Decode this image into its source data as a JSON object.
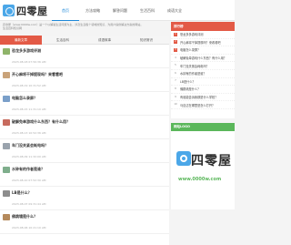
{
  "site": {
    "logo_text": "四零屋"
  },
  "nav": [
    {
      "label": "首页",
      "active": true
    },
    {
      "label": "方法攻略",
      "active": false
    },
    {
      "label": "解答问题",
      "active": false
    },
    {
      "label": "生活百科",
      "active": false
    },
    {
      "label": "成语大全",
      "active": false
    }
  ],
  "notice": {
    "line1": "四零屋（www.0000w.com）是一个以解答生活问题为主，涉及生活各个领域的知识，为用户提供解决方案的网站。",
    "line2": "生活百科知识网"
  },
  "tabs": [
    {
      "label": "最新文章",
      "active": true
    },
    {
      "label": "生活百科",
      "active": false
    },
    {
      "label": "成语故事",
      "active": false
    },
    {
      "label": "知识常识",
      "active": false
    }
  ],
  "articles": [
    {
      "title": "恐龙多多游戏评测",
      "date": "2023-08-18 07:50:36 AM",
      "tag": "",
      "thumb": "#8fb46a"
    },
    {
      "title": "开心麻将干掉提现吗？来看看吧",
      "date": "2023-08-19 10:31:52 AM",
      "tag": "",
      "thumb": "#c9a37a"
    },
    {
      "title": "电脑怎么录屏？",
      "date": "2023-08-15 11:31:10 AM",
      "tag": "",
      "thumb": "#7a9fc9"
    },
    {
      "title": "破解免单游戏什么东西？有什么用？",
      "date": "2023-08-13 10:52:36 AM",
      "tag": "",
      "thumb": "#c76b5e"
    },
    {
      "title": "车门没关紧会耗电吗？",
      "date": "2023-08-09 11:32:00 AM",
      "tag": "",
      "thumb": "#9aa3ad"
    },
    {
      "title": "水钟有的作者是谁？",
      "date": "2023-08-10 07:52:30 AM",
      "tag": "",
      "thumb": "#7fae8c"
    },
    {
      "title": "LB是什么？",
      "date": "2023-08-07 09:31:44 AM",
      "tag": "",
      "thumb": "#8d8d8d"
    },
    {
      "title": "佛跳墙是什么？",
      "date": "2023-08-06 10:21:10 AM",
      "tag": "",
      "thumb": "#b58a5c"
    }
  ],
  "ranking": {
    "title": "排行榜",
    "items": [
      "恐龙多多游戏评测",
      "开心麻将干掉提现吗？来看看吧",
      "电脑怎么录屏？",
      "破解免单游戏什么东西？有什么用？",
      "车门没关紧会耗电吗？",
      "水钟有的作者是谁？",
      "LB是什么？",
      "佛跳墙是什么？",
      "有谁能告诉我那是什么学校？",
      "马自达在哪里是怎么打开？"
    ]
  },
  "ad": {
    "title": "网站LOGO",
    "logo_text": "四零屋",
    "url": "www.0000w.com"
  }
}
